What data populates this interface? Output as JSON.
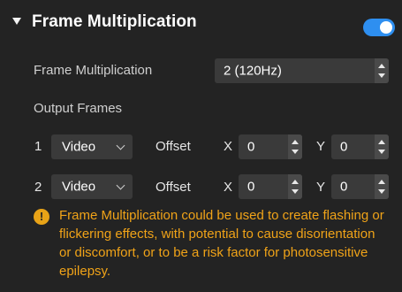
{
  "section": {
    "title": "Frame Multiplication",
    "enabled": true
  },
  "frame_multiplication": {
    "label": "Frame Multiplication",
    "value": "2 (120Hz)"
  },
  "output_frames": {
    "label": "Output Frames",
    "rows": [
      {
        "index": "1",
        "source": "Video",
        "offset_label": "Offset",
        "x_label": "X",
        "x_value": "0",
        "y_label": "Y",
        "y_value": "0"
      },
      {
        "index": "2",
        "source": "Video",
        "offset_label": "Offset",
        "x_label": "X",
        "x_value": "0",
        "y_label": "Y",
        "y_value": "0"
      }
    ]
  },
  "warning": {
    "icon": "exclamation-icon",
    "icon_glyph": "!",
    "text": "Frame Multiplication could be used to create flashing or flickering effects, with potential to cause disorientation or discomfort, or to be a risk factor for photosensitive epilepsy.",
    "color": "#f0a318"
  },
  "colors": {
    "accent": "#2e8ff0",
    "background": "#232323",
    "field": "#3a3a3a"
  }
}
